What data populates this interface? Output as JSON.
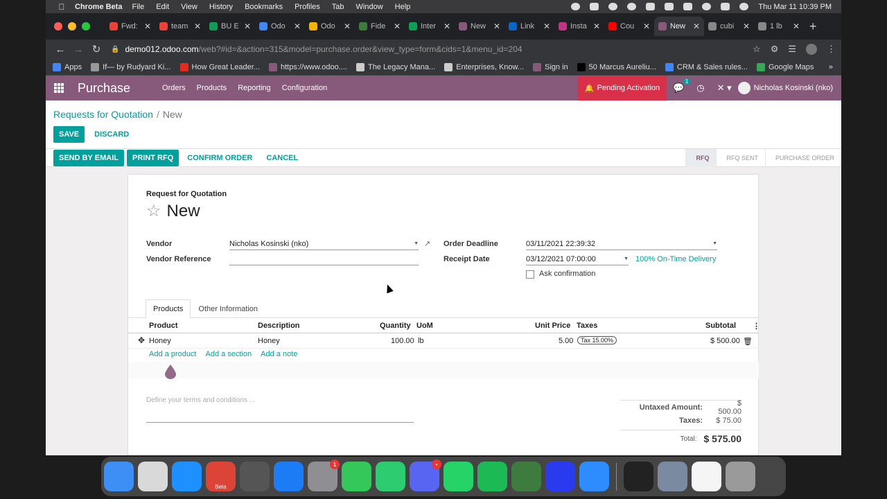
{
  "menubar": {
    "app_name": "Chrome Beta",
    "items": [
      "File",
      "Edit",
      "View",
      "History",
      "Bookmarks",
      "Profiles",
      "Tab",
      "Window",
      "Help"
    ],
    "clock": "Thu Mar 11  10:39 PM"
  },
  "browser": {
    "tabs": [
      {
        "title": "Fwd:",
        "color": "#ea4335"
      },
      {
        "title": "team",
        "color": "#ea4335"
      },
      {
        "title": "BU E",
        "color": "#0f9d58"
      },
      {
        "title": "Odo",
        "color": "#4285f4"
      },
      {
        "title": "Odo",
        "color": "#f4b400"
      },
      {
        "title": "Fide",
        "color": "#3e7b3e"
      },
      {
        "title": "Inter",
        "color": "#0f9d58"
      },
      {
        "title": "New",
        "color": "#875a7b"
      },
      {
        "title": "Link",
        "color": "#0a66c2"
      },
      {
        "title": "Insta",
        "color": "#c13584"
      },
      {
        "title": "Cou",
        "color": "#ff0000"
      },
      {
        "title": "New",
        "color": "#875a7b",
        "active": true
      },
      {
        "title": "cubi",
        "color": "#888888"
      },
      {
        "title": "1 lb",
        "color": "#888888"
      }
    ],
    "url_host": "demo012.odoo.com",
    "url_path": "/web?#id=&action=315&model=purchase.order&view_type=form&cids=1&menu_id=204",
    "bookmarks": [
      {
        "label": "Apps",
        "color": "#4285f4"
      },
      {
        "label": "If— by Rudyard Ki...",
        "color": "#999999"
      },
      {
        "label": "How Great Leader...",
        "color": "#e62b1e"
      },
      {
        "label": "https://www.odoo....",
        "color": "#875a7b"
      },
      {
        "label": "The Legacy Mana...",
        "color": "#cccccc"
      },
      {
        "label": "Enterprises, Know...",
        "color": "#cccccc"
      },
      {
        "label": "Sign in",
        "color": "#875a7b"
      },
      {
        "label": "50 Marcus Aureliu...",
        "color": "#000000"
      },
      {
        "label": "CRM & Sales rules...",
        "color": "#4285f4"
      },
      {
        "label": "Google Maps",
        "color": "#34a853"
      }
    ],
    "bookmarks_more": "»"
  },
  "odoo_nav": {
    "brand": "Purchase",
    "menu": [
      "Orders",
      "Products",
      "Reporting",
      "Configuration"
    ],
    "pending": "Pending Activation",
    "chat_badge": "1",
    "user": "Nicholas Kosinski (nko)"
  },
  "control": {
    "breadcrumb_parent": "Requests for Quotation",
    "breadcrumb_sep": "/",
    "breadcrumb_current": "New",
    "save": "SAVE",
    "discard": "DISCARD",
    "actions": {
      "send_email": "SEND BY EMAIL",
      "print_rfq": "PRINT RFQ",
      "confirm": "CONFIRM ORDER",
      "cancel": "CANCEL"
    },
    "status_steps": [
      "RFQ",
      "RFQ SENT",
      "PURCHASE ORDER"
    ],
    "active_step": "RFQ"
  },
  "form": {
    "doc_label": "Request for Quotation",
    "doc_name": "New",
    "vendor_label": "Vendor",
    "vendor_value": "Nicholas Kosinski (nko)",
    "vendor_ref_label": "Vendor Reference",
    "vendor_ref_value": "",
    "order_deadline_label": "Order Deadline",
    "order_deadline_value": "03/11/2021 22:39:32",
    "receipt_date_label": "Receipt Date",
    "receipt_date_value": "03/12/2021 07:00:00",
    "on_time": "100% On-Time Delivery",
    "ask_confirmation": "Ask confirmation",
    "tabs": [
      "Products",
      "Other Information"
    ],
    "columns": {
      "product": "Product",
      "description": "Description",
      "quantity": "Quantity",
      "uom": "UoM",
      "unit_price": "Unit Price",
      "taxes": "Taxes",
      "subtotal": "Subtotal"
    },
    "lines": [
      {
        "product": "Honey",
        "description": "Honey",
        "quantity": "100.00",
        "uom": "lb",
        "unit_price": "5.00",
        "taxes": "Tax 15.00%",
        "subtotal": "$ 500.00"
      }
    ],
    "add_product": "Add a product",
    "add_section": "Add a section",
    "add_note": "Add a note",
    "terms_placeholder": "Define your terms and conditions ...",
    "totals": {
      "untaxed_label": "Untaxed Amount:",
      "untaxed_value": "$ 500.00",
      "taxes_label": "Taxes:",
      "taxes_value": "$ 75.00",
      "total_label": "Total:",
      "total_value": "$ 575.00"
    }
  },
  "dock": {
    "apps": [
      {
        "name": "finder",
        "color": "#3d8ff5"
      },
      {
        "name": "launchpad",
        "color": "#d9d9d9"
      },
      {
        "name": "safari",
        "color": "#1e90ff"
      },
      {
        "name": "chrome-beta",
        "color": "#db4437",
        "label": "Beta"
      },
      {
        "name": "quicktime",
        "color": "#555555"
      },
      {
        "name": "app-store",
        "color": "#1c7cf5"
      },
      {
        "name": "system-preferences",
        "color": "#8e8e93",
        "badge": "1"
      },
      {
        "name": "messages",
        "color": "#34c759"
      },
      {
        "name": "facetime",
        "color": "#2ecc71"
      },
      {
        "name": "discord",
        "color": "#5865f2",
        "badge": "•"
      },
      {
        "name": "whatsapp",
        "color": "#25d366"
      },
      {
        "name": "spotify",
        "color": "#1db954"
      },
      {
        "name": "fidelity",
        "color": "#3e7b3e"
      },
      {
        "name": "dialpad",
        "color": "#2a3bef"
      },
      {
        "name": "zoom",
        "color": "#2d8cff"
      }
    ],
    "apps_right": [
      {
        "name": "terminal",
        "color": "#222222"
      },
      {
        "name": "preview",
        "color": "#7a8aa0"
      },
      {
        "name": "textedit",
        "color": "#f5f5f5"
      },
      {
        "name": "trash",
        "color": "#9a9a9a"
      }
    ]
  }
}
